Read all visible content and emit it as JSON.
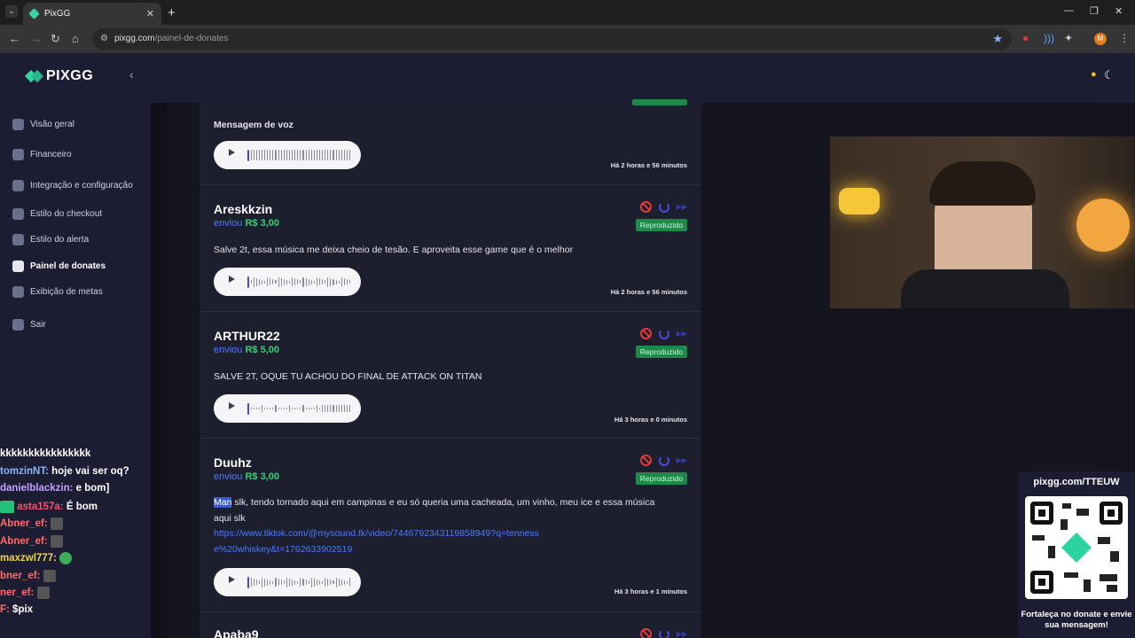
{
  "browser": {
    "tab_title": "PixGG",
    "url_host": "pixgg.com",
    "url_path": "/painel-de-donates",
    "profile_initial": "M"
  },
  "sidebar": {
    "logo": "PIXGG",
    "items": [
      {
        "label": "Visão geral",
        "icon": "home-icon"
      },
      {
        "label": "Financeiro",
        "icon": "wallet-icon"
      },
      {
        "label": "Integração e configuração",
        "icon": "settings-icon"
      },
      {
        "label": "Estilo do checkout",
        "icon": "palette-icon"
      },
      {
        "label": "Estilo do alerta",
        "icon": "palette-icon"
      },
      {
        "label": "Painel de donates",
        "icon": "donate-icon",
        "active": true
      },
      {
        "label": "Exibição de metas",
        "icon": "star-icon"
      },
      {
        "label": "Sair",
        "icon": "logout-icon"
      }
    ]
  },
  "donates": [
    {
      "name": "",
      "message": "Mensagem de voz",
      "time": "Há 2 horas e 56 minutos"
    },
    {
      "name": "Areskkzin",
      "sent_label": "enviou",
      "amount": "R$ 3,00",
      "status": "Reproduzido",
      "message": "Salve 2t, essa música me deixa cheio de tesão. E aproveita esse game que é o melhor",
      "time": "Há 2 horas e 56 minutos"
    },
    {
      "name": "ARTHUR22",
      "sent_label": "enviou",
      "amount": "R$ 5,00",
      "status": "Reproduzido",
      "message": "SALVE 2T, OQUE TU ACHOU DO FINAL DE ATTACK ON TITAN",
      "time": "Há 3 horas e 0 minutos"
    },
    {
      "name": "Duuhz",
      "sent_label": "enviou",
      "amount": "R$ 3,00",
      "status": "Reproduzido",
      "message_highlight": "Man",
      "message_rest": " slk, tendo tornado aqui em campinas e eu só queria uma cacheada, um vinho, meu ice e essa música aqui slk",
      "link": "https://www.tiktok.com/@mysound.tk/video/7446792343119858949?q=tennesse%20whiskey&t=1762633902519",
      "time": "Há 3 horas e 1 minutos"
    },
    {
      "name": "Apaba9"
    }
  ],
  "chat": [
    {
      "user": "",
      "text": "kkkkkkkkkkkkkkkk",
      "color": "#ffffff"
    },
    {
      "user": "tomzinNT:",
      "text": " hoje vai ser oq?",
      "color": "#8ab4f8"
    },
    {
      "user": "danielblackzin:",
      "text": " e bom]",
      "color": "#c7a0ff"
    },
    {
      "user": "asta157a:",
      "text": " É bom",
      "color": "#ff4d6d"
    },
    {
      "user": "Abner_ef:",
      "text": "",
      "color": "#ff6b6b"
    },
    {
      "user": "Abner_ef:",
      "text": "",
      "color": "#ff6b6b"
    },
    {
      "user": "maxzwl777:",
      "text": "",
      "color": "#e8d44d"
    },
    {
      "user": "bner_ef:",
      "text": "",
      "color": "#ff6b6b"
    },
    {
      "user": "ner_ef:",
      "text": "",
      "color": "#ff6b6b"
    },
    {
      "user": "F:",
      "text": " $pix",
      "color": "#ff6b6b"
    }
  ],
  "qr": {
    "title": "pixgg.com/TTEUW",
    "caption": "Fortaleça no donate e envie sua mensagem!"
  }
}
